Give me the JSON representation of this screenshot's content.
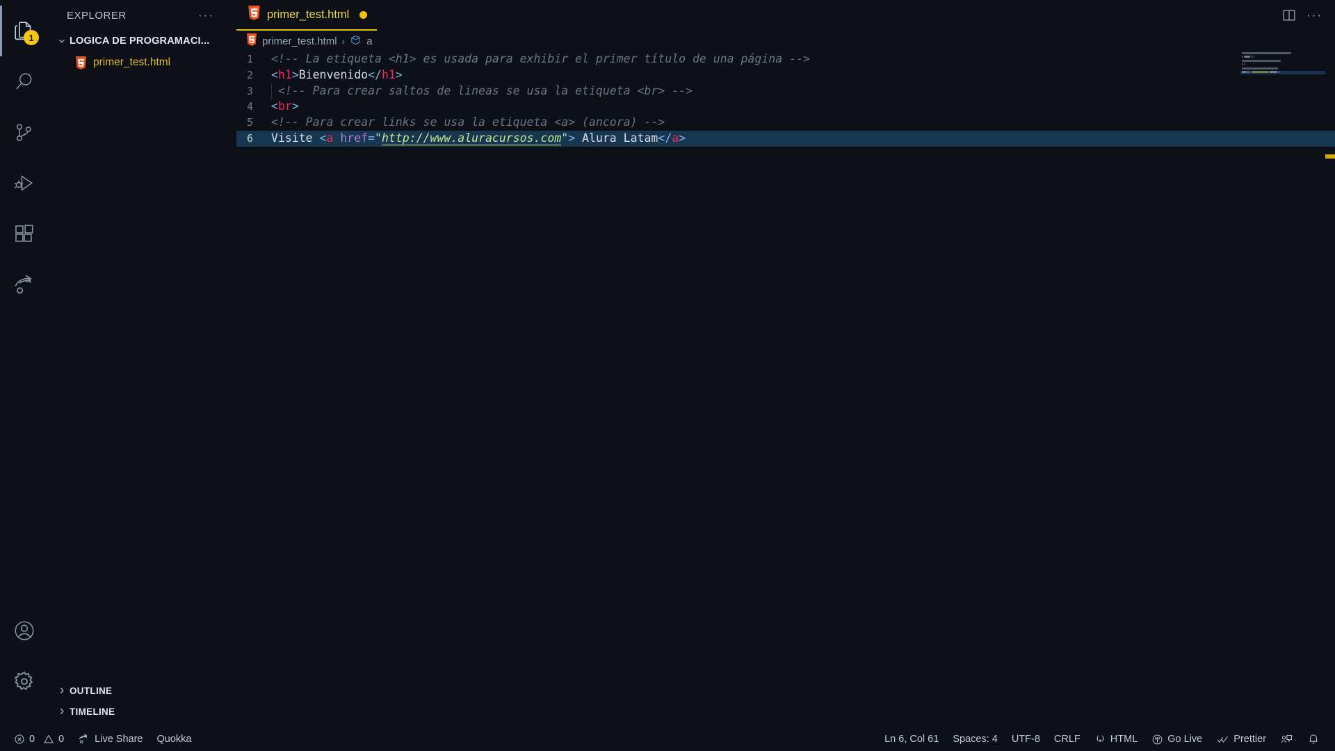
{
  "activity_bar": {
    "items": [
      {
        "name": "explorer",
        "icon": "files-icon",
        "active": true,
        "badge": "1"
      },
      {
        "name": "search",
        "icon": "search-icon",
        "active": false,
        "badge": ""
      },
      {
        "name": "source-control",
        "icon": "source-control-icon",
        "active": false,
        "badge": ""
      },
      {
        "name": "run-debug",
        "icon": "run-and-debug-icon",
        "active": false,
        "badge": ""
      },
      {
        "name": "extensions",
        "icon": "extensions-icon",
        "active": false,
        "badge": ""
      },
      {
        "name": "live-share",
        "icon": "live-share-icon",
        "active": false,
        "badge": ""
      }
    ],
    "bottom_items": [
      {
        "name": "accounts",
        "icon": "account-icon"
      },
      {
        "name": "manage",
        "icon": "gear-icon"
      }
    ]
  },
  "sidebar": {
    "title": "EXPLORER",
    "more_actions": "···",
    "folder": {
      "label": "LOGICA DE PROGRAMACI...",
      "expanded": true
    },
    "files": [
      {
        "label": "primer_test.html",
        "icon": "html5-icon"
      }
    ],
    "bottom_sections": [
      {
        "label": "OUTLINE",
        "expanded": false
      },
      {
        "label": "TIMELINE",
        "expanded": false
      }
    ]
  },
  "editor": {
    "tab": {
      "label": "primer_test.html",
      "icon": "html5-icon",
      "dirty": true
    },
    "actions": [
      {
        "name": "split-editor-right-icon"
      },
      {
        "name": "more-actions-icon",
        "label": "···"
      }
    ],
    "breadcrumb": [
      {
        "label": "primer_test.html",
        "icon": "html5-icon"
      },
      {
        "label": "a",
        "icon": "symbol-field-icon"
      }
    ],
    "highlighted_line": 6,
    "lines": [
      {
        "number": "1",
        "indent_guide": false,
        "tokens": [
          {
            "t": "comment",
            "s": "<!-- La etiqueta <h1> es usada para exhibir el primer título de una página -->"
          }
        ]
      },
      {
        "number": "2",
        "indent_guide": false,
        "tokens": [
          {
            "t": "bracket",
            "s": "<"
          },
          {
            "t": "tag",
            "s": "h1"
          },
          {
            "t": "bracket",
            "s": ">"
          },
          {
            "t": "plain",
            "s": "Bienvenido"
          },
          {
            "t": "bracket",
            "s": "</"
          },
          {
            "t": "tag",
            "s": "h1"
          },
          {
            "t": "bracket",
            "s": ">"
          }
        ]
      },
      {
        "number": "3",
        "indent_guide": true,
        "tokens": [
          {
            "t": "comment",
            "s": " <!-- Para crear saltos de lineas se usa la etiqueta <br> -->"
          }
        ]
      },
      {
        "number": "4",
        "indent_guide": false,
        "tokens": [
          {
            "t": "bracket",
            "s": "<"
          },
          {
            "t": "tag",
            "s": "br"
          },
          {
            "t": "bracket",
            "s": ">"
          }
        ]
      },
      {
        "number": "5",
        "indent_guide": false,
        "tokens": [
          {
            "t": "comment",
            "s": "<!-- Para crear links se usa la etiqueta <a> (ancora) -->"
          }
        ]
      },
      {
        "number": "6",
        "indent_guide": false,
        "tokens": [
          {
            "t": "plain",
            "s": "Visite "
          },
          {
            "t": "bracket",
            "s": "<"
          },
          {
            "t": "tag",
            "s": "a"
          },
          {
            "t": "plain",
            "s": " "
          },
          {
            "t": "attr",
            "s": "href"
          },
          {
            "t": "bracket",
            "s": "="
          },
          {
            "t": "quote",
            "s": "\""
          },
          {
            "t": "link",
            "s": "http://www.aluracursos.com"
          },
          {
            "t": "quote",
            "s": "\""
          },
          {
            "t": "bracket",
            "s": ">"
          },
          {
            "t": "plain",
            "s": " Alura Latam"
          },
          {
            "t": "bracket",
            "s": "</"
          },
          {
            "t": "tag",
            "s": "a"
          },
          {
            "t": "bracket",
            "s": ">"
          }
        ]
      }
    ]
  },
  "status_bar": {
    "left": [
      {
        "name": "problems",
        "icon": "error-icon",
        "label": "0",
        "second_icon": "warning-icon",
        "second_label": "0"
      },
      {
        "name": "live-share",
        "icon": "live-share-icon",
        "label": "Live Share"
      },
      {
        "name": "quokka",
        "icon": "",
        "label": "Quokka"
      }
    ],
    "right": [
      {
        "name": "cursor-position",
        "icon": "",
        "label": "Ln 6, Col 61"
      },
      {
        "name": "indentation",
        "icon": "",
        "label": "Spaces: 4"
      },
      {
        "name": "encoding",
        "icon": "",
        "label": "UTF-8"
      },
      {
        "name": "eol",
        "icon": "",
        "label": "CRLF"
      },
      {
        "name": "language-mode",
        "icon": "braces-icon",
        "label": "HTML"
      },
      {
        "name": "go-live",
        "icon": "broadcast-icon",
        "label": "Go Live"
      },
      {
        "name": "prettier",
        "icon": "check-all-icon",
        "label": "Prettier"
      },
      {
        "name": "feedback",
        "icon": "feedback-icon",
        "label": ""
      },
      {
        "name": "notifications",
        "icon": "bell-icon",
        "label": ""
      }
    ]
  },
  "colors": {
    "background": "#0d1117",
    "accent_yellow": "#e8d44d",
    "tab_underline": "#e3c000",
    "selection": "#173650",
    "string_green": "#c3e88d",
    "tag_pink": "#f2285f",
    "attr_purple": "#b07ddb"
  }
}
